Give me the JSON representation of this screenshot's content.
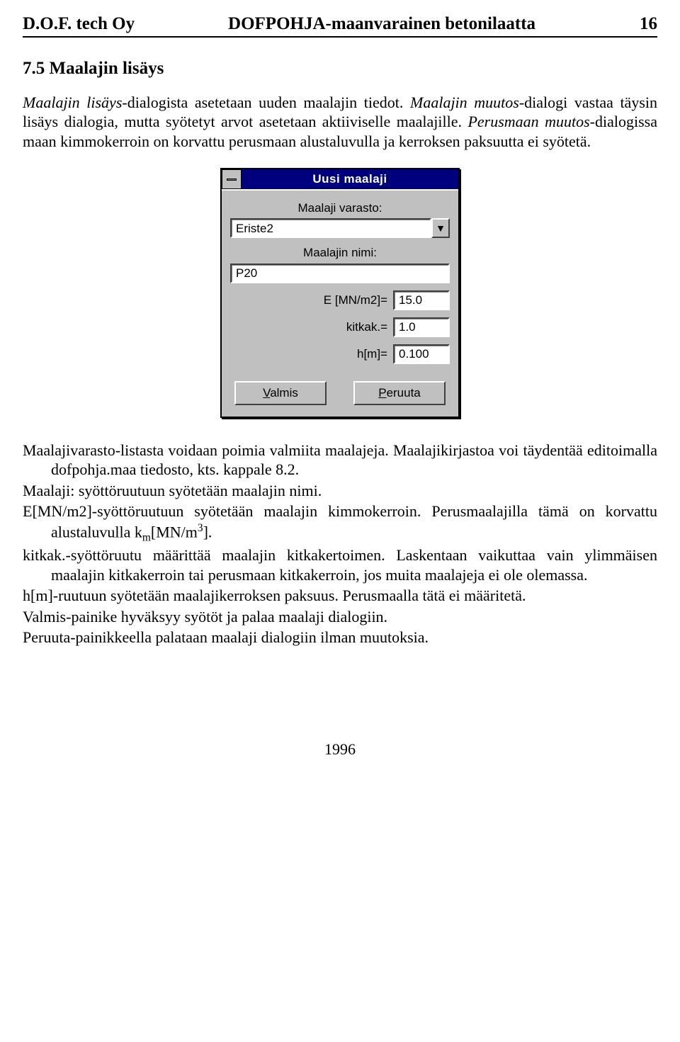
{
  "header": {
    "left": "D.O.F. tech Oy",
    "center": "DOFPOHJA-maanvarainen betonilaatta",
    "page": "16"
  },
  "section": {
    "number": "7.5",
    "title": "Maalajin lisäys"
  },
  "intro": {
    "sent1_a": "Maalajin lisäys",
    "sent1_b": "-dialogista asetetaan uuden maalajin tiedot. ",
    "sent2_a": "Maalajin muutos",
    "sent2_b": "-dialogi vastaa täysin lisäys dialogia, mutta syötetyt arvot asetetaan aktiiviselle maalajille. ",
    "sent3_a": "Perusmaan muutos",
    "sent3_b": "-dialogissa maan kimmokerroin on korvattu perusmaan alustaluvulla ja kerroksen paksuutta ei syötetä."
  },
  "dialog": {
    "title": "Uusi maalaji",
    "label_varasto": "Maalaji varasto:",
    "combo_value": "Eriste2",
    "label_nimi": "Maalajin nimi:",
    "name_value": "P20",
    "row_e_label": "E [MN/m2]=",
    "row_e_value": "15.0",
    "row_kitkak_label": "kitkak.=",
    "row_kitkak_value": "1.0",
    "row_h_label": "h[m]=",
    "row_h_value": "0.100",
    "btn_ok_u": "V",
    "btn_ok_rest": "almis",
    "btn_cancel_u": "P",
    "btn_cancel_rest": "eruuta"
  },
  "desc": {
    "maalajivarasto_a": "Maalajivarasto",
    "maalajivarasto_b": "-listasta voidaan poimia valmiita maalajeja. Maalajikirjastoa voi täydentää editoimalla dofpohja.maa tiedosto, kts. kappale 8.2.",
    "maalaji_a": "Maalaji:",
    "maalaji_b": " syöttöruutuun syötetään maalajin nimi.",
    "e_a": "E[MN/m2]",
    "e_b": "-syöttöruutuun syötetään maalajin kimmokerroin. Perusmaalajilla tämä on korvattu alustaluvulla k",
    "e_sub": "m",
    "e_unit": "[MN/m",
    "e_sup": "3",
    "e_tail": "].",
    "kitkak_a": "kitkak.",
    "kitkak_b": "-syöttöruutu määrittää maalajin kitkakertoimen. Laskentaan vaikuttaa vain ylimmäisen maalajin kitkakerroin tai perusmaan kitkakerroin, jos muita maalajeja ei ole olemassa.",
    "h_a": "h[m]",
    "h_b": "-ruutuun syötetään maalajikerroksen paksuus. Perusmaalla tätä ei määritetä.",
    "valmis_a": "Valmis",
    "valmis_b": "-painike hyväksyy syötöt ja palaa maalaji dialogiin.",
    "peruuta_a": "Peruuta",
    "peruuta_b": "-painikkeella palataan maalaji dialogiin ilman muutoksia."
  },
  "footer": {
    "year": "1996"
  }
}
